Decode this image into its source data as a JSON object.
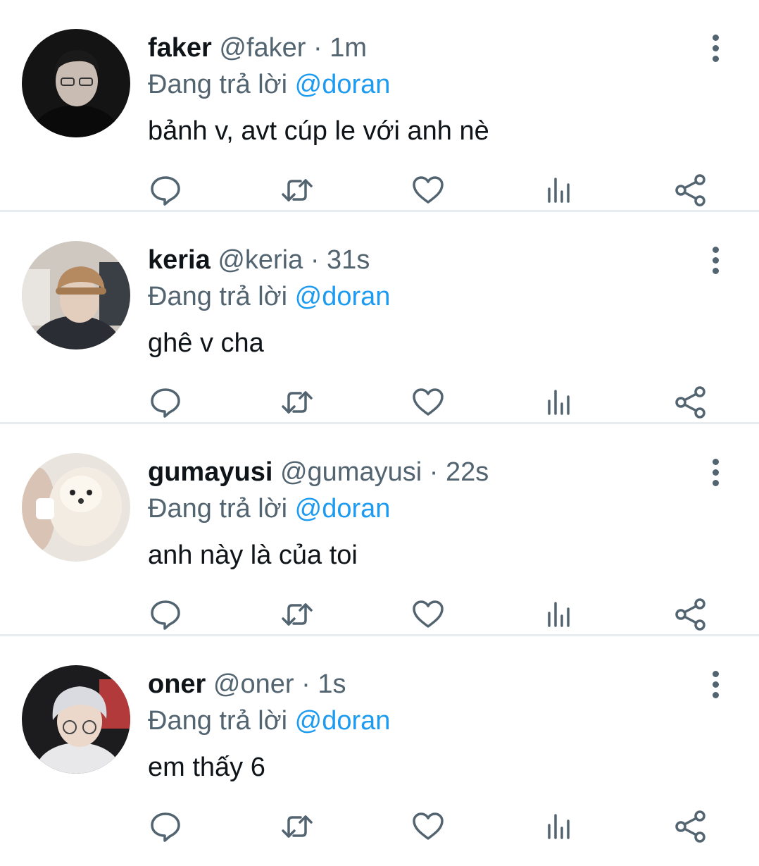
{
  "reply_prefix": "Đang trả lời",
  "separator": "·",
  "colors": {
    "text": "#0f1419",
    "secondary": "#536471",
    "mention": "#1d9bf0",
    "divider": "#e6ecf0"
  },
  "icons": [
    "reply-icon",
    "retweet-icon",
    "like-icon",
    "stats-icon",
    "share-icon",
    "more-icon"
  ],
  "tweets": [
    {
      "name": "faker",
      "handle": "@faker",
      "time": "1m",
      "reply_to": "@doran",
      "text": "bảnh v, avt cúp le với anh nè"
    },
    {
      "name": "keria",
      "handle": "@keria",
      "time": "31s",
      "reply_to": "@doran",
      "text": "ghê v cha"
    },
    {
      "name": "gumayusi",
      "handle": "@gumayusi",
      "time": "22s",
      "reply_to": "@doran",
      "text": "anh này là của toi"
    },
    {
      "name": "oner",
      "handle": "@oner",
      "time": "1s",
      "reply_to": "@doran",
      "text": "em thấy 6"
    }
  ]
}
